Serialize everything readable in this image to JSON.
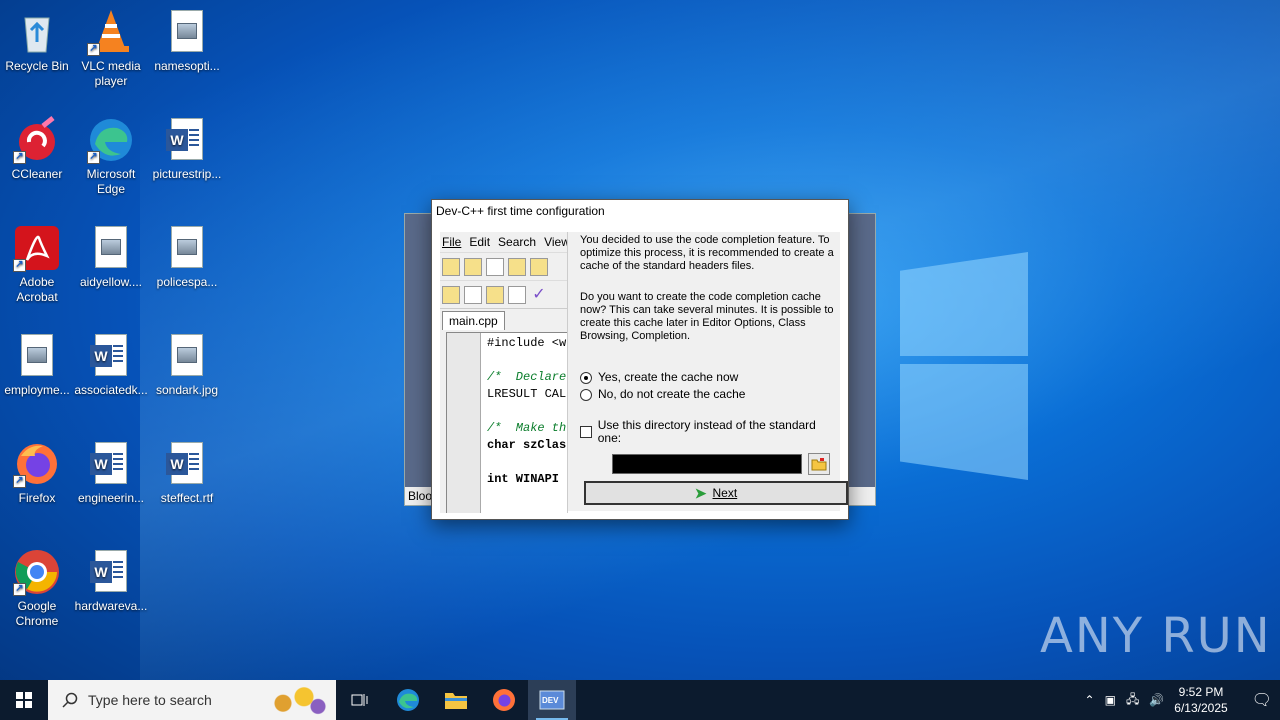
{
  "desktop_icons": [
    {
      "id": "recycle",
      "label": "Recycle Bin"
    },
    {
      "id": "vlc",
      "label": "VLC media player"
    },
    {
      "id": "namesopti",
      "label": "namesopti..."
    },
    {
      "id": "ccleaner",
      "label": "CCleaner"
    },
    {
      "id": "edge",
      "label": "Microsoft Edge"
    },
    {
      "id": "picturestrip",
      "label": "picturestrip..."
    },
    {
      "id": "acrobat",
      "label": "Adobe Acrobat"
    },
    {
      "id": "aidyellow",
      "label": "aidyellow...."
    },
    {
      "id": "policespa",
      "label": "policespa..."
    },
    {
      "id": "employme",
      "label": "employme..."
    },
    {
      "id": "associatedk",
      "label": "associatedk..."
    },
    {
      "id": "sondark",
      "label": "sondark.jpg"
    },
    {
      "id": "firefox",
      "label": "Firefox"
    },
    {
      "id": "engineerin",
      "label": "engineerin..."
    },
    {
      "id": "steffect",
      "label": "steffect.rtf"
    },
    {
      "id": "chrome",
      "label": "Google Chrome"
    },
    {
      "id": "hardwareva",
      "label": "hardwareva..."
    }
  ],
  "back_window": {
    "status_text": "Bloo"
  },
  "dialog": {
    "title": "Dev-C++ first time configuration",
    "preview": {
      "menu": [
        "File",
        "Edit",
        "Search",
        "View"
      ],
      "tab": "main.cpp",
      "code_lines": [
        "#include <w",
        "",
        "/*  Declare",
        "LRESULT CAL",
        "",
        "/*  Make th",
        "char szClas",
        "",
        "int WINAPI"
      ]
    },
    "paragraph1": "You decided to use the code completion feature. To optimize this process, it is recommended to create a cache of the standard headers files.",
    "paragraph2": "Do you want to create the code completion cache now? This can take several minutes. It is possible to create this cache later in Editor Options, Class Browsing, Completion.",
    "radio_yes": "Yes, create the cache now",
    "radio_no": "No, do not create the cache",
    "radio_selected": "yes",
    "checkbox_label": "Use this directory instead of the standard one:",
    "checkbox_checked": false,
    "directory_value": "",
    "next_label": "Next"
  },
  "watermark": "ANY RUN",
  "taskbar": {
    "search_placeholder": "Type here to search",
    "time": "9:52 PM",
    "date": "6/13/2025"
  }
}
